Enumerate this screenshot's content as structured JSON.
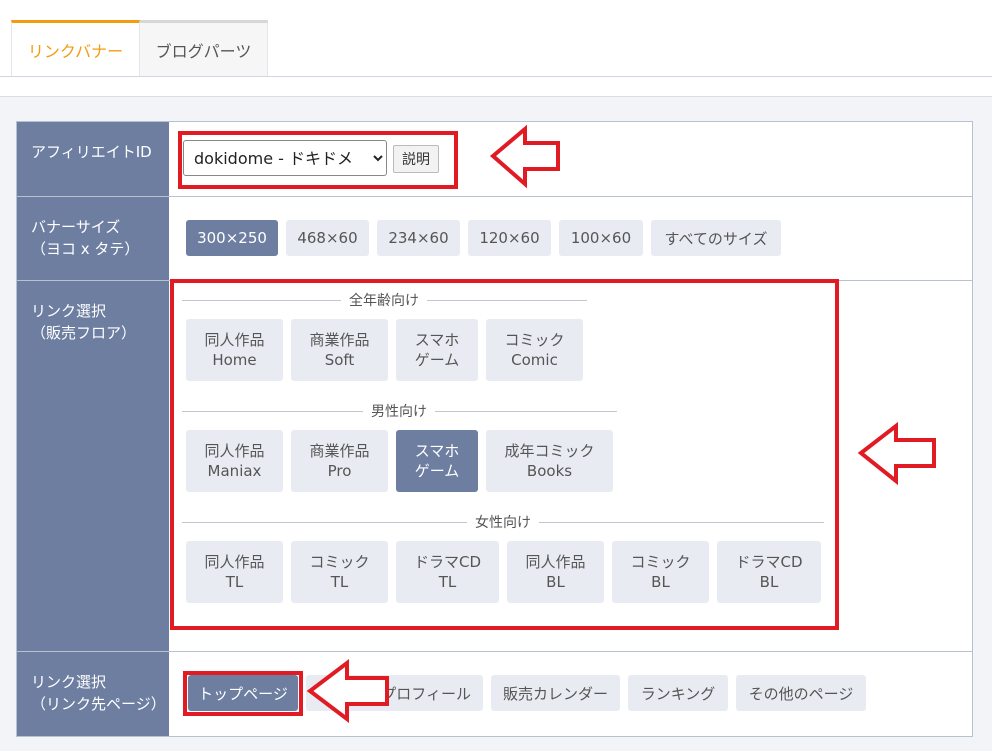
{
  "tabs": [
    {
      "label": "リンクバナー",
      "active": true
    },
    {
      "label": "ブログパーツ",
      "active": false
    }
  ],
  "affiliate": {
    "label": "アフィリエイトID",
    "selected": "dokidome - ドキドメ",
    "explain_label": "説明"
  },
  "banner_size": {
    "label_line1": "バナーサイズ",
    "label_line2": "（ヨコ x タテ）",
    "options": [
      "300×250",
      "468×60",
      "234×60",
      "120×60",
      "100×60",
      "すべてのサイズ"
    ],
    "selected_index": 0
  },
  "floor": {
    "label_line1": "リンク選択",
    "label_line2": "（販売フロア）",
    "groups": [
      {
        "title": "全年齢向け",
        "items": [
          {
            "line1": "同人作品",
            "line2": "Home"
          },
          {
            "line1": "商業作品",
            "line2": "Soft"
          },
          {
            "line1": "スマホ",
            "line2": "ゲーム"
          },
          {
            "line1": "コミック",
            "line2": "Comic"
          }
        ]
      },
      {
        "title": "男性向け",
        "items": [
          {
            "line1": "同人作品",
            "line2": "Maniax"
          },
          {
            "line1": "商業作品",
            "line2": "Pro"
          },
          {
            "line1": "スマホ",
            "line2": "ゲーム"
          },
          {
            "line1": "成年コミック",
            "line2": "Books"
          }
        ]
      },
      {
        "title": "女性向け",
        "items": [
          {
            "line1": "同人作品",
            "line2": "TL"
          },
          {
            "line1": "コミック",
            "line2": "TL"
          },
          {
            "line1": "ドラマCD",
            "line2": "TL"
          },
          {
            "line1": "同人作品",
            "line2": "BL"
          },
          {
            "line1": "コミック",
            "line2": "BL"
          },
          {
            "line1": "ドラマCD",
            "line2": "BL"
          }
        ]
      }
    ]
  },
  "page": {
    "label_line1": "リンク選択",
    "label_line2": "（リンク先ページ）",
    "options": [
      "トップページ",
      "プロフィール",
      "販売カレンダー",
      "ランキング",
      "その他のページ"
    ],
    "selected_index": 0
  },
  "colors": {
    "accent": "#f39c12",
    "label_bg": "#6d7ea1",
    "annotation_red": "#e01b24"
  }
}
